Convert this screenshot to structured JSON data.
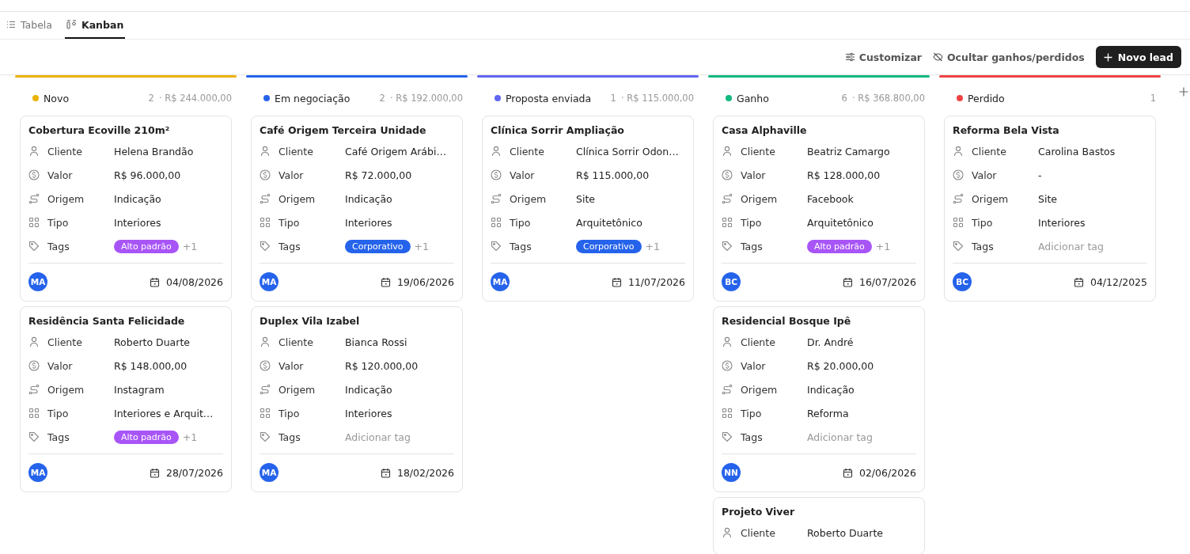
{
  "tabs": [
    {
      "label": "Tabela",
      "selected": false
    },
    {
      "label": "Kanban",
      "selected": true
    }
  ],
  "toolbar": {
    "customize": "Customizar",
    "hide": "Ocultar ganhos/perdidos",
    "new": "Novo lead"
  },
  "columns": [
    {
      "name": "Novo",
      "color": "#eab308",
      "count": "2",
      "total": "· R$ 244.000,00",
      "cards": [
        {
          "title": "Cobertura Ecoville 210m²",
          "fields": [
            {
              "kind": "cliente",
              "label": "Cliente",
              "value": "Helena Brandão"
            },
            {
              "kind": "valor",
              "label": "Valor",
              "value": "R$ 96.000,00"
            },
            {
              "kind": "origem",
              "label": "Origem",
              "value": "Indicação"
            },
            {
              "kind": "tipo",
              "label": "Tipo",
              "value": "Interiores"
            },
            {
              "kind": "tags",
              "label": "Tags",
              "tag": {
                "label": "Alto padrão",
                "color": "#a855f7"
              },
              "more": "+1"
            }
          ],
          "avatar": "MA",
          "date": "04/08/2026"
        },
        {
          "title": "Residência Santa Felicidade",
          "fields": [
            {
              "kind": "cliente",
              "label": "Cliente",
              "value": "Roberto Duarte"
            },
            {
              "kind": "valor",
              "label": "Valor",
              "value": "R$ 148.000,00"
            },
            {
              "kind": "origem",
              "label": "Origem",
              "value": "Instagram"
            },
            {
              "kind": "tipo",
              "label": "Tipo",
              "value": "Interiores e Arquit…"
            },
            {
              "kind": "tags",
              "label": "Tags",
              "tag": {
                "label": "Alto padrão",
                "color": "#a855f7"
              },
              "more": "+1"
            }
          ],
          "avatar": "MA",
          "date": "28/07/2026"
        }
      ]
    },
    {
      "name": "Em negociação",
      "color": "#2563eb",
      "count": "2",
      "total": "· R$ 192.000,00",
      "cards": [
        {
          "title": "Café Origem Terceira Unidade",
          "fields": [
            {
              "kind": "cliente",
              "label": "Cliente",
              "value": "Café Origem Arábi…"
            },
            {
              "kind": "valor",
              "label": "Valor",
              "value": "R$ 72.000,00"
            },
            {
              "kind": "origem",
              "label": "Origem",
              "value": "Indicação"
            },
            {
              "kind": "tipo",
              "label": "Tipo",
              "value": "Interiores"
            },
            {
              "kind": "tags",
              "label": "Tags",
              "tag": {
                "label": "Corporativo",
                "color": "#2563eb"
              },
              "more": "+1"
            }
          ],
          "avatar": "MA",
          "date": "19/06/2026"
        },
        {
          "title": "Duplex Vila Izabel",
          "fields": [
            {
              "kind": "cliente",
              "label": "Cliente",
              "value": "Bianca Rossi"
            },
            {
              "kind": "valor",
              "label": "Valor",
              "value": "R$ 120.000,00"
            },
            {
              "kind": "origem",
              "label": "Origem",
              "value": "Indicação"
            },
            {
              "kind": "tipo",
              "label": "Tipo",
              "value": "Interiores"
            },
            {
              "kind": "tags",
              "label": "Tags",
              "empty": "Adicionar tag"
            }
          ],
          "avatar": "MA",
          "date": "18/02/2026"
        }
      ]
    },
    {
      "name": "Proposta enviada",
      "color": "#6366f1",
      "count": "1",
      "total": "· R$ 115.000,00",
      "cards": [
        {
          "title": "Clínica Sorrir Ampliação",
          "fields": [
            {
              "kind": "cliente",
              "label": "Cliente",
              "value": "Clínica Sorrir Odon…"
            },
            {
              "kind": "valor",
              "label": "Valor",
              "value": "R$ 115.000,00"
            },
            {
              "kind": "origem",
              "label": "Origem",
              "value": "Site"
            },
            {
              "kind": "tipo",
              "label": "Tipo",
              "value": "Arquitetônico"
            },
            {
              "kind": "tags",
              "label": "Tags",
              "tag": {
                "label": "Corporativo",
                "color": "#2563eb"
              },
              "more": "+1"
            }
          ],
          "avatar": "MA",
          "date": "11/07/2026"
        }
      ]
    },
    {
      "name": "Ganho",
      "color": "#10b981",
      "count": "6",
      "total": "· R$ 368.800,00",
      "cards": [
        {
          "title": "Casa Alphaville",
          "fields": [
            {
              "kind": "cliente",
              "label": "Cliente",
              "value": "Beatriz Camargo"
            },
            {
              "kind": "valor",
              "label": "Valor",
              "value": "R$ 128.000,00"
            },
            {
              "kind": "origem",
              "label": "Origem",
              "value": "Facebook"
            },
            {
              "kind": "tipo",
              "label": "Tipo",
              "value": "Arquitetônico"
            },
            {
              "kind": "tags",
              "label": "Tags",
              "tag": {
                "label": "Alto padrão",
                "color": "#a855f7"
              },
              "more": "+1"
            }
          ],
          "avatar": "BC",
          "date": "16/07/2026"
        },
        {
          "title": "Residencial Bosque Ipê",
          "fields": [
            {
              "kind": "cliente",
              "label": "Cliente",
              "value": "Dr. André"
            },
            {
              "kind": "valor",
              "label": "Valor",
              "value": "R$ 20.000,00"
            },
            {
              "kind": "origem",
              "label": "Origem",
              "value": "Indicação"
            },
            {
              "kind": "tipo",
              "label": "Tipo",
              "value": "Reforma"
            },
            {
              "kind": "tags",
              "label": "Tags",
              "empty": "Adicionar tag"
            }
          ],
          "avatar": "NN",
          "date": "02/06/2026"
        },
        {
          "title": "Projeto Viver",
          "fields": [
            {
              "kind": "cliente",
              "label": "Cliente",
              "value": "Roberto Duarte"
            }
          ]
        }
      ]
    },
    {
      "name": "Perdido",
      "color": "#ef4444",
      "count": "1",
      "cards": [
        {
          "title": "Reforma Bela Vista",
          "fields": [
            {
              "kind": "cliente",
              "label": "Cliente",
              "value": "Carolina Bastos"
            },
            {
              "kind": "valor",
              "label": "Valor",
              "value": "-"
            },
            {
              "kind": "origem",
              "label": "Origem",
              "value": "Site"
            },
            {
              "kind": "tipo",
              "label": "Tipo",
              "value": "Interiores"
            },
            {
              "kind": "tags",
              "label": "Tags",
              "empty": "Adicionar tag"
            }
          ],
          "avatar": "BC",
          "date": "04/12/2025"
        }
      ]
    }
  ]
}
